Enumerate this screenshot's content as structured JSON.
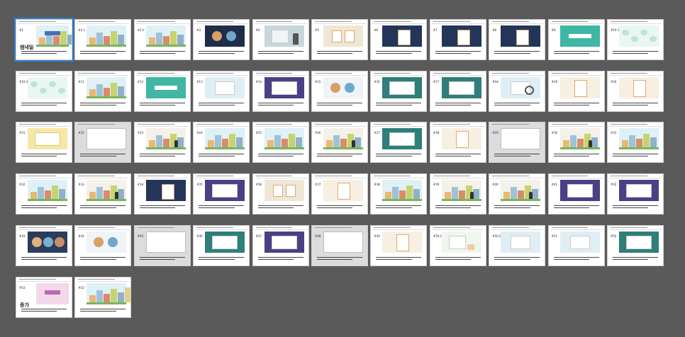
{
  "window": {
    "background": "#5a5a5a"
  },
  "theme": {
    "header_color": "#999999",
    "caption_color": "#444444",
    "highlight": "#2a7fd4"
  },
  "slides": [
    {
      "label": "#1",
      "title": "썸네일",
      "style": "cover",
      "selected": true
    },
    {
      "label": "#2-1",
      "style": "town"
    },
    {
      "label": "#2-2",
      "style": "town"
    },
    {
      "label": "#3",
      "style": "circles"
    },
    {
      "label": "#4",
      "style": "photo"
    },
    {
      "label": "#5",
      "style": "cards"
    },
    {
      "label": "#6",
      "style": "navy-card"
    },
    {
      "label": "#7",
      "style": "navy-card"
    },
    {
      "label": "#8",
      "style": "navy-card"
    },
    {
      "label": "#9",
      "style": "teal-banner"
    },
    {
      "label": "#10-1",
      "style": "mindmap"
    },
    {
      "label": "#10-2",
      "style": "mindmap"
    },
    {
      "label": "#11",
      "style": "town"
    },
    {
      "label": "#12",
      "style": "teal-banner"
    },
    {
      "label": "#13",
      "style": "doc-blue"
    },
    {
      "label": "#14",
      "style": "purple-frame"
    },
    {
      "label": "#15",
      "style": "circles-light"
    },
    {
      "label": "#16",
      "style": "teal-frame"
    },
    {
      "label": "#17",
      "style": "teal-frame"
    },
    {
      "label": "#18",
      "style": "doc-search"
    },
    {
      "label": "#19",
      "style": "orange-doc"
    },
    {
      "label": "#20",
      "style": "orange-doc"
    },
    {
      "label": "#21",
      "style": "yellow-card"
    },
    {
      "label": "#22",
      "style": "grey"
    },
    {
      "label": "#23",
      "style": "street"
    },
    {
      "label": "#24",
      "style": "town"
    },
    {
      "label": "#25",
      "style": "town"
    },
    {
      "label": "#26",
      "style": "street"
    },
    {
      "label": "#27",
      "style": "teal-frame"
    },
    {
      "label": "#28",
      "style": "orange-doc"
    },
    {
      "label": "#29",
      "style": "grey"
    },
    {
      "label": "#30",
      "style": "street"
    },
    {
      "label": "#31",
      "style": "town"
    },
    {
      "label": "#32",
      "style": "town"
    },
    {
      "label": "#33",
      "style": "street"
    },
    {
      "label": "#34",
      "style": "navy-card"
    },
    {
      "label": "#35",
      "style": "purple-frame"
    },
    {
      "label": "#36",
      "style": "cards"
    },
    {
      "label": "#37",
      "style": "orange-doc"
    },
    {
      "label": "#38",
      "style": "town"
    },
    {
      "label": "#39",
      "style": "street"
    },
    {
      "label": "#40",
      "style": "street"
    },
    {
      "label": "#41",
      "style": "purple-frame"
    },
    {
      "label": "#42",
      "style": "purple-frame"
    },
    {
      "label": "#43",
      "style": "people"
    },
    {
      "label": "#44",
      "style": "circles-light"
    },
    {
      "label": "#45",
      "style": "grey"
    },
    {
      "label": "#46",
      "style": "teal-frame"
    },
    {
      "label": "#47",
      "style": "purple-frame"
    },
    {
      "label": "#48",
      "style": "grey"
    },
    {
      "label": "#49",
      "style": "orange-doc"
    },
    {
      "label": "#50-1",
      "style": "hand"
    },
    {
      "label": "#50-2",
      "style": "doc-blue"
    },
    {
      "label": "#51",
      "style": "doc-blue"
    },
    {
      "label": "#52",
      "style": "teal-frame"
    },
    {
      "label": "#53",
      "title": "종가",
      "style": "pink"
    },
    {
      "label": "#53",
      "style": "city"
    }
  ]
}
